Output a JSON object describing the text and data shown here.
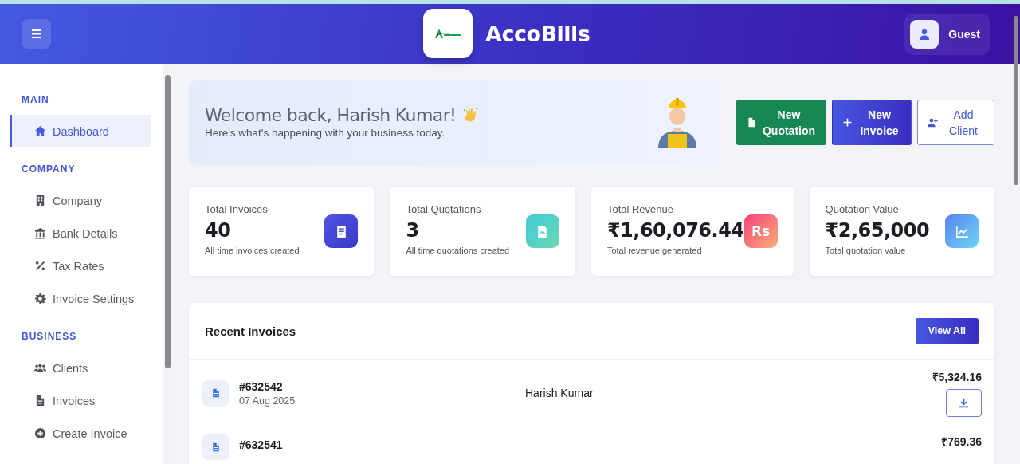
{
  "header": {
    "title": "AccoBills",
    "user": "Guest"
  },
  "sidebar": {
    "sections": [
      {
        "label": "MAIN",
        "items": [
          {
            "label": "Dashboard",
            "selected": true
          }
        ]
      },
      {
        "label": "COMPANY",
        "items": [
          {
            "label": "Company",
            "selected": false
          },
          {
            "label": "Bank Details",
            "selected": false
          },
          {
            "label": "Tax Rates",
            "selected": false
          },
          {
            "label": "Invoice Settings",
            "selected": false
          }
        ]
      },
      {
        "label": "BUSINESS",
        "items": [
          {
            "label": "Clients",
            "selected": false
          },
          {
            "label": "Invoices",
            "selected": false
          },
          {
            "label": "Create Invoice",
            "selected": false
          }
        ]
      }
    ]
  },
  "welcome": {
    "title": "Welcome back, Harish Kumar!",
    "subtitle": "Here's what's happening with your business today."
  },
  "actions": [
    {
      "label": "New Quotation",
      "kind": "success"
    },
    {
      "label": "New Invoice",
      "kind": "primary"
    },
    {
      "label": "Add Client",
      "kind": "outline"
    }
  ],
  "stats": [
    {
      "label": "Total Invoices",
      "value": "40",
      "caption": "All time invoices created"
    },
    {
      "label": "Total Quotations",
      "value": "3",
      "caption": "All time quotations created"
    },
    {
      "label": "Total Revenue",
      "value": "₹1,60,076.44",
      "caption": "Total revenue generated",
      "badge": "Rs"
    },
    {
      "label": "Quotation Value",
      "value": "₹2,65,000",
      "caption": "Total quotation value"
    }
  ],
  "recent_invoices": {
    "title": "Recent Invoices",
    "view_all": "View All",
    "rows": [
      {
        "number": "#632542",
        "date": "07 Aug 2025",
        "client": "Harish Kumar",
        "amount": "₹5,324.16"
      },
      {
        "number": "#632541",
        "amount": "₹769.36"
      }
    ]
  }
}
